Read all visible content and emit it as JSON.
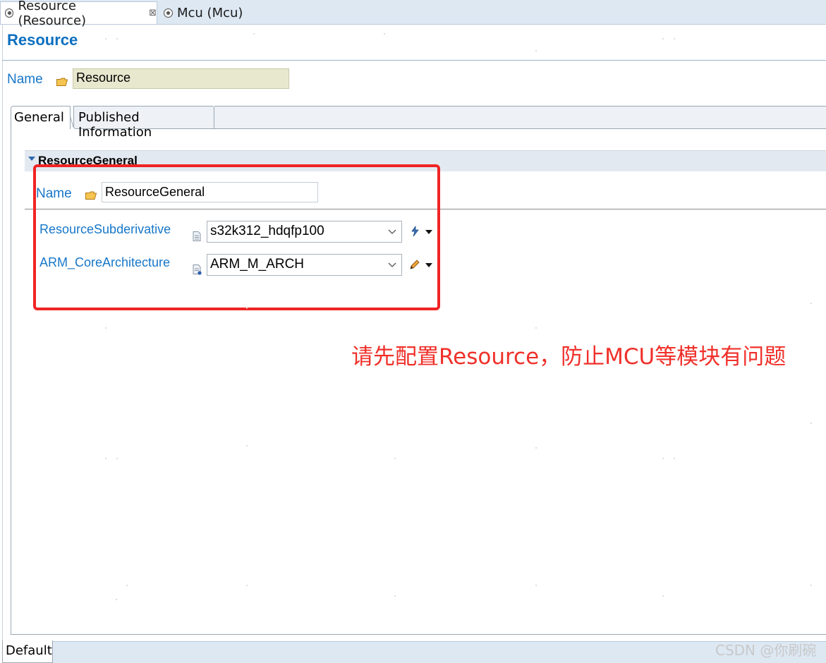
{
  "editor_tabs": [
    {
      "label": "Resource (Resource)",
      "close": "⊠"
    },
    {
      "label": "Mcu (Mcu)"
    }
  ],
  "page_title": "Resource",
  "name_row": {
    "label": "Name",
    "value": "Resource"
  },
  "section_tabs": [
    {
      "label": "General"
    },
    {
      "label": "Published Information"
    }
  ],
  "section": {
    "title": "ResourceGeneral",
    "name_label": "Name",
    "name_value": "ResourceGeneral",
    "params": [
      {
        "label": "ResourceSubderivative",
        "value": "s32k312_hdqfp100"
      },
      {
        "label": "ARM_CoreArchitecture",
        "value": "ARM_M_ARCH"
      }
    ]
  },
  "annotation_text": "请先配置Resource，防止MCU等模块有问题",
  "bottom_tab": "Default",
  "watermark": "CSDN @你刷碗",
  "colors": {
    "accent_blue": "#0b6fc0",
    "label_blue": "#1777c9",
    "annotation_red": "#f02424"
  }
}
